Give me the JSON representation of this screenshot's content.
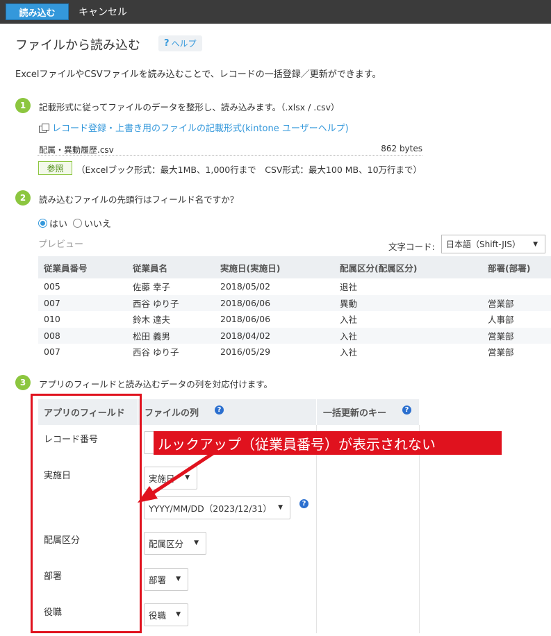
{
  "toolbar": {
    "import_label": "読み込む",
    "cancel_label": "キャンセル"
  },
  "header": {
    "title": "ファイルから読み込む",
    "help_label": "ヘルプ",
    "help_glyph": "?"
  },
  "intro": "ExcelファイルやCSVファイルを読み込むことで、レコードの一括登録／更新ができます。",
  "step1": {
    "number": "1",
    "text": "記載形式に従ってファイルのデータを整形し、読み込みます。（.xlsx / .csv）",
    "link": "レコード登録・上書き用のファイルの記載形式(kintone ユーザーヘルプ)",
    "file_name": "配属・異動履歴.csv",
    "file_size": "862 bytes",
    "browse_label": "参照",
    "limit_note": "（Excelブック形式：最大1MB、1,000行まで　CSV形式：最大100 MB、10万行まで）"
  },
  "step2": {
    "number": "2",
    "text": "読み込むファイルの先頭行はフィールド名ですか？",
    "yes_label": "はい",
    "no_label": "いいえ",
    "preview_label": "プレビュー",
    "encoding_label": "文字コード:",
    "encoding_value": "日本語（Shift-JIS）",
    "columns": [
      "従業員番号",
      "従業員名",
      "実施日(実施日)",
      "配属区分(配属区分)",
      "部署(部署)"
    ],
    "rows": [
      [
        "005",
        "佐藤 幸子",
        "2018/05/02",
        "退社",
        ""
      ],
      [
        "007",
        "西谷 ゆり子",
        "2018/06/06",
        "異動",
        "営業部"
      ],
      [
        "010",
        "鈴木 達夫",
        "2018/06/06",
        "入社",
        "人事部"
      ],
      [
        "008",
        "松田 義男",
        "2018/04/02",
        "入社",
        "営業部"
      ],
      [
        "007",
        "西谷 ゆり子",
        "2016/05/29",
        "入社",
        "営業部"
      ]
    ]
  },
  "step3": {
    "number": "3",
    "text": "アプリのフィールドと読み込むデータの列を対応付けます。",
    "col_app_field": "アプリのフィールド",
    "col_file_column": "ファイルの列",
    "col_update_key": "一括更新のキー",
    "fields": {
      "record_no": "レコード番号",
      "date": "実施日",
      "assignment": "配属区分",
      "dept": "部署",
      "position": "役職"
    },
    "selects": {
      "date": "実施日",
      "date_format": "YYYY/MM/DD（2023/12/31）",
      "assignment": "配属区分",
      "dept": "部署",
      "position": "役職"
    }
  },
  "annotation": {
    "callout": "ルックアップ（従業員番号）が表示されない",
    "color": "#e0121e"
  }
}
